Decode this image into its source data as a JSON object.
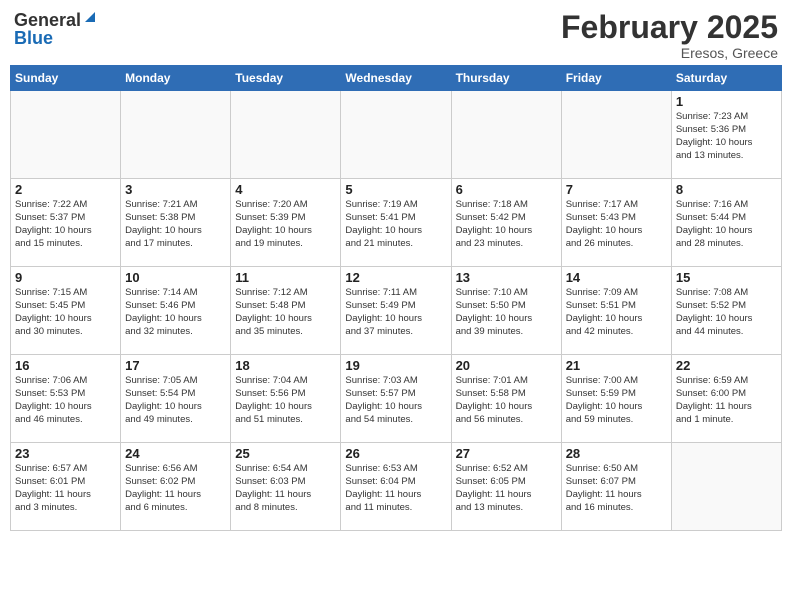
{
  "header": {
    "logo_general": "General",
    "logo_blue": "Blue",
    "month_year": "February 2025",
    "location": "Eresos, Greece"
  },
  "days_of_week": [
    "Sunday",
    "Monday",
    "Tuesday",
    "Wednesday",
    "Thursday",
    "Friday",
    "Saturday"
  ],
  "weeks": [
    [
      {
        "day": "",
        "info": ""
      },
      {
        "day": "",
        "info": ""
      },
      {
        "day": "",
        "info": ""
      },
      {
        "day": "",
        "info": ""
      },
      {
        "day": "",
        "info": ""
      },
      {
        "day": "",
        "info": ""
      },
      {
        "day": "1",
        "info": "Sunrise: 7:23 AM\nSunset: 5:36 PM\nDaylight: 10 hours\nand 13 minutes."
      }
    ],
    [
      {
        "day": "2",
        "info": "Sunrise: 7:22 AM\nSunset: 5:37 PM\nDaylight: 10 hours\nand 15 minutes."
      },
      {
        "day": "3",
        "info": "Sunrise: 7:21 AM\nSunset: 5:38 PM\nDaylight: 10 hours\nand 17 minutes."
      },
      {
        "day": "4",
        "info": "Sunrise: 7:20 AM\nSunset: 5:39 PM\nDaylight: 10 hours\nand 19 minutes."
      },
      {
        "day": "5",
        "info": "Sunrise: 7:19 AM\nSunset: 5:41 PM\nDaylight: 10 hours\nand 21 minutes."
      },
      {
        "day": "6",
        "info": "Sunrise: 7:18 AM\nSunset: 5:42 PM\nDaylight: 10 hours\nand 23 minutes."
      },
      {
        "day": "7",
        "info": "Sunrise: 7:17 AM\nSunset: 5:43 PM\nDaylight: 10 hours\nand 26 minutes."
      },
      {
        "day": "8",
        "info": "Sunrise: 7:16 AM\nSunset: 5:44 PM\nDaylight: 10 hours\nand 28 minutes."
      }
    ],
    [
      {
        "day": "9",
        "info": "Sunrise: 7:15 AM\nSunset: 5:45 PM\nDaylight: 10 hours\nand 30 minutes."
      },
      {
        "day": "10",
        "info": "Sunrise: 7:14 AM\nSunset: 5:46 PM\nDaylight: 10 hours\nand 32 minutes."
      },
      {
        "day": "11",
        "info": "Sunrise: 7:12 AM\nSunset: 5:48 PM\nDaylight: 10 hours\nand 35 minutes."
      },
      {
        "day": "12",
        "info": "Sunrise: 7:11 AM\nSunset: 5:49 PM\nDaylight: 10 hours\nand 37 minutes."
      },
      {
        "day": "13",
        "info": "Sunrise: 7:10 AM\nSunset: 5:50 PM\nDaylight: 10 hours\nand 39 minutes."
      },
      {
        "day": "14",
        "info": "Sunrise: 7:09 AM\nSunset: 5:51 PM\nDaylight: 10 hours\nand 42 minutes."
      },
      {
        "day": "15",
        "info": "Sunrise: 7:08 AM\nSunset: 5:52 PM\nDaylight: 10 hours\nand 44 minutes."
      }
    ],
    [
      {
        "day": "16",
        "info": "Sunrise: 7:06 AM\nSunset: 5:53 PM\nDaylight: 10 hours\nand 46 minutes."
      },
      {
        "day": "17",
        "info": "Sunrise: 7:05 AM\nSunset: 5:54 PM\nDaylight: 10 hours\nand 49 minutes."
      },
      {
        "day": "18",
        "info": "Sunrise: 7:04 AM\nSunset: 5:56 PM\nDaylight: 10 hours\nand 51 minutes."
      },
      {
        "day": "19",
        "info": "Sunrise: 7:03 AM\nSunset: 5:57 PM\nDaylight: 10 hours\nand 54 minutes."
      },
      {
        "day": "20",
        "info": "Sunrise: 7:01 AM\nSunset: 5:58 PM\nDaylight: 10 hours\nand 56 minutes."
      },
      {
        "day": "21",
        "info": "Sunrise: 7:00 AM\nSunset: 5:59 PM\nDaylight: 10 hours\nand 59 minutes."
      },
      {
        "day": "22",
        "info": "Sunrise: 6:59 AM\nSunset: 6:00 PM\nDaylight: 11 hours\nand 1 minute."
      }
    ],
    [
      {
        "day": "23",
        "info": "Sunrise: 6:57 AM\nSunset: 6:01 PM\nDaylight: 11 hours\nand 3 minutes."
      },
      {
        "day": "24",
        "info": "Sunrise: 6:56 AM\nSunset: 6:02 PM\nDaylight: 11 hours\nand 6 minutes."
      },
      {
        "day": "25",
        "info": "Sunrise: 6:54 AM\nSunset: 6:03 PM\nDaylight: 11 hours\nand 8 minutes."
      },
      {
        "day": "26",
        "info": "Sunrise: 6:53 AM\nSunset: 6:04 PM\nDaylight: 11 hours\nand 11 minutes."
      },
      {
        "day": "27",
        "info": "Sunrise: 6:52 AM\nSunset: 6:05 PM\nDaylight: 11 hours\nand 13 minutes."
      },
      {
        "day": "28",
        "info": "Sunrise: 6:50 AM\nSunset: 6:07 PM\nDaylight: 11 hours\nand 16 minutes."
      },
      {
        "day": "",
        "info": ""
      }
    ]
  ]
}
